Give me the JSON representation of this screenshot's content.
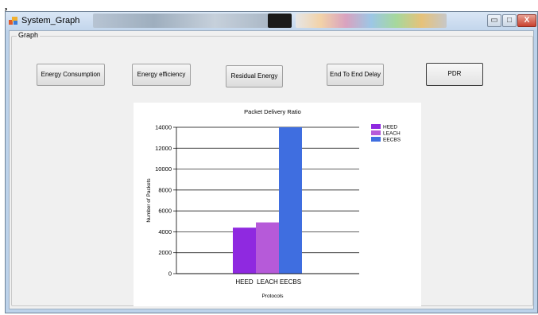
{
  "stray_mark": ",",
  "window": {
    "title": "System_Graph",
    "controls": {
      "minimize": "▭",
      "maximize": "□",
      "close": "X"
    }
  },
  "group": {
    "label": "Graph"
  },
  "buttons": {
    "energy_consumption": "Energy Consumption",
    "energy_efficiency": "Energy efficiency",
    "residual_energy": "Residual Energy",
    "end_to_end_delay": "End To End Delay",
    "pdr": "PDR"
  },
  "colors": {
    "heed": "#8f29e0",
    "leach": "#b65ad9",
    "eecbs": "#3f6ee0",
    "window_frame": "#bcd2ea",
    "client_bg": "#f0f0f0"
  },
  "chart_data": {
    "type": "bar",
    "title": "Packet Delivery Ratio",
    "xlabel": "Protocols",
    "ylabel": "Number of Packets",
    "ylim": [
      0,
      14000
    ],
    "yticks": [
      "0",
      "2000",
      "4000",
      "6000",
      "8000",
      "10000",
      "12000",
      "14000"
    ],
    "categories": [
      "HEED",
      "LEACH",
      "EECBS"
    ],
    "values": [
      4400,
      4900,
      14000
    ],
    "legend": [
      "HEED",
      "LEACH",
      "EECBS"
    ],
    "legend_position": "top-right",
    "grid": true
  }
}
